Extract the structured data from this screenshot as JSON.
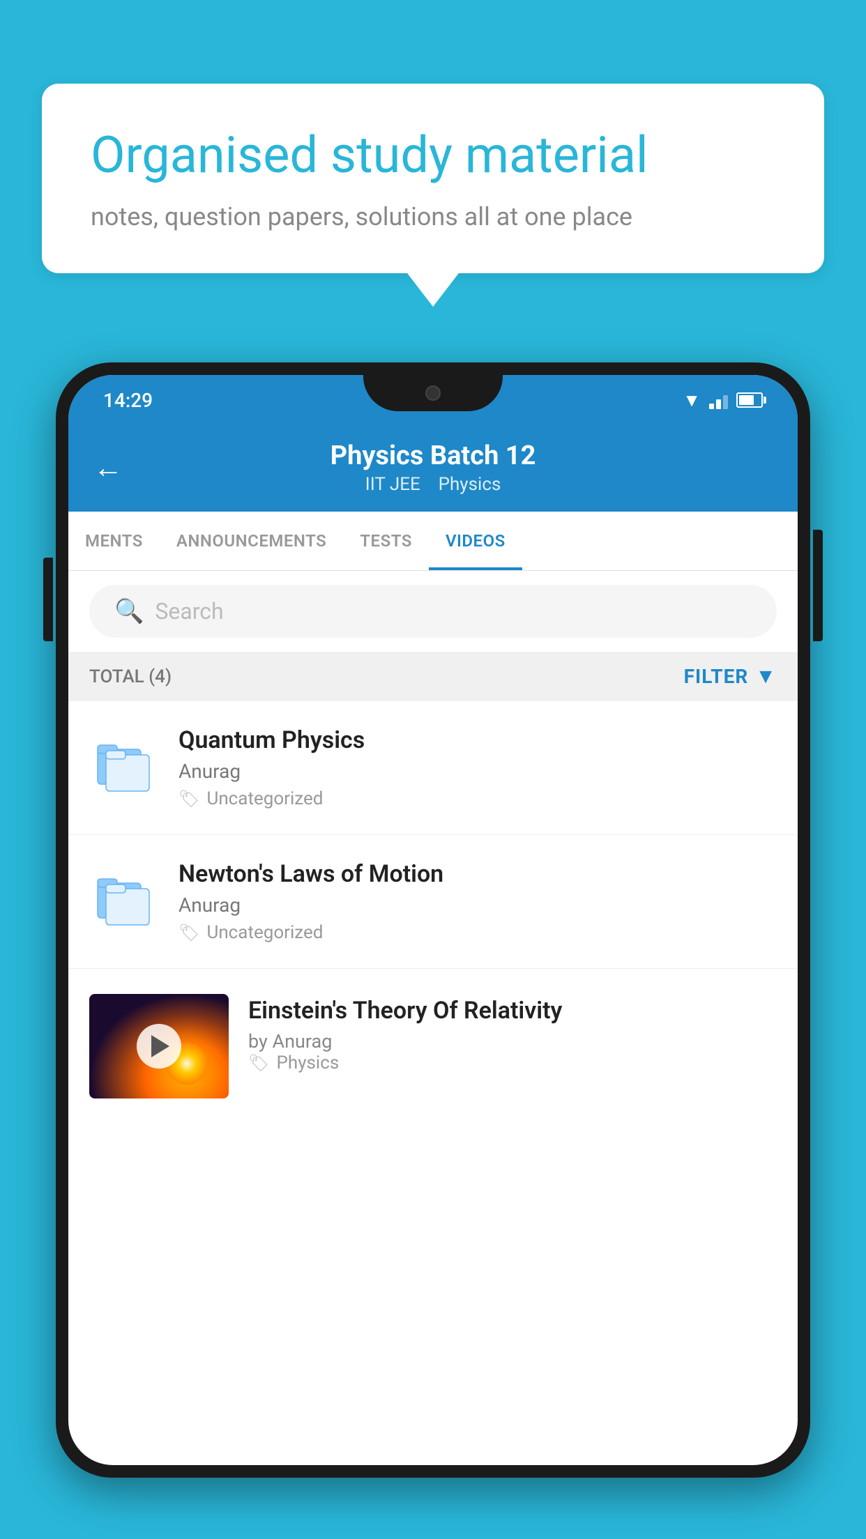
{
  "background_color": "#29B6D8",
  "hero": {
    "bubble_title": "Organised study material",
    "bubble_subtitle": "notes, question papers, solutions all at one place"
  },
  "phone": {
    "status_bar": {
      "time": "14:29"
    },
    "header": {
      "title": "Physics Batch 12",
      "subtitle_part1": "IIT JEE",
      "subtitle_part2": "Physics",
      "back_label": "Back"
    },
    "tabs": [
      {
        "label": "MENTS",
        "active": false
      },
      {
        "label": "ANNOUNCEMENTS",
        "active": false
      },
      {
        "label": "TESTS",
        "active": false
      },
      {
        "label": "VIDEOS",
        "active": true
      }
    ],
    "search": {
      "placeholder": "Search"
    },
    "filter": {
      "total_label": "TOTAL (4)",
      "filter_label": "FILTER"
    },
    "videos": [
      {
        "title": "Quantum Physics",
        "author": "Anurag",
        "tag": "Uncategorized",
        "type": "folder"
      },
      {
        "title": "Newton's Laws of Motion",
        "author": "Anurag",
        "tag": "Uncategorized",
        "type": "folder"
      },
      {
        "title": "Einstein's Theory Of Relativity",
        "author": "by Anurag",
        "tag": "Physics",
        "type": "video"
      }
    ]
  }
}
